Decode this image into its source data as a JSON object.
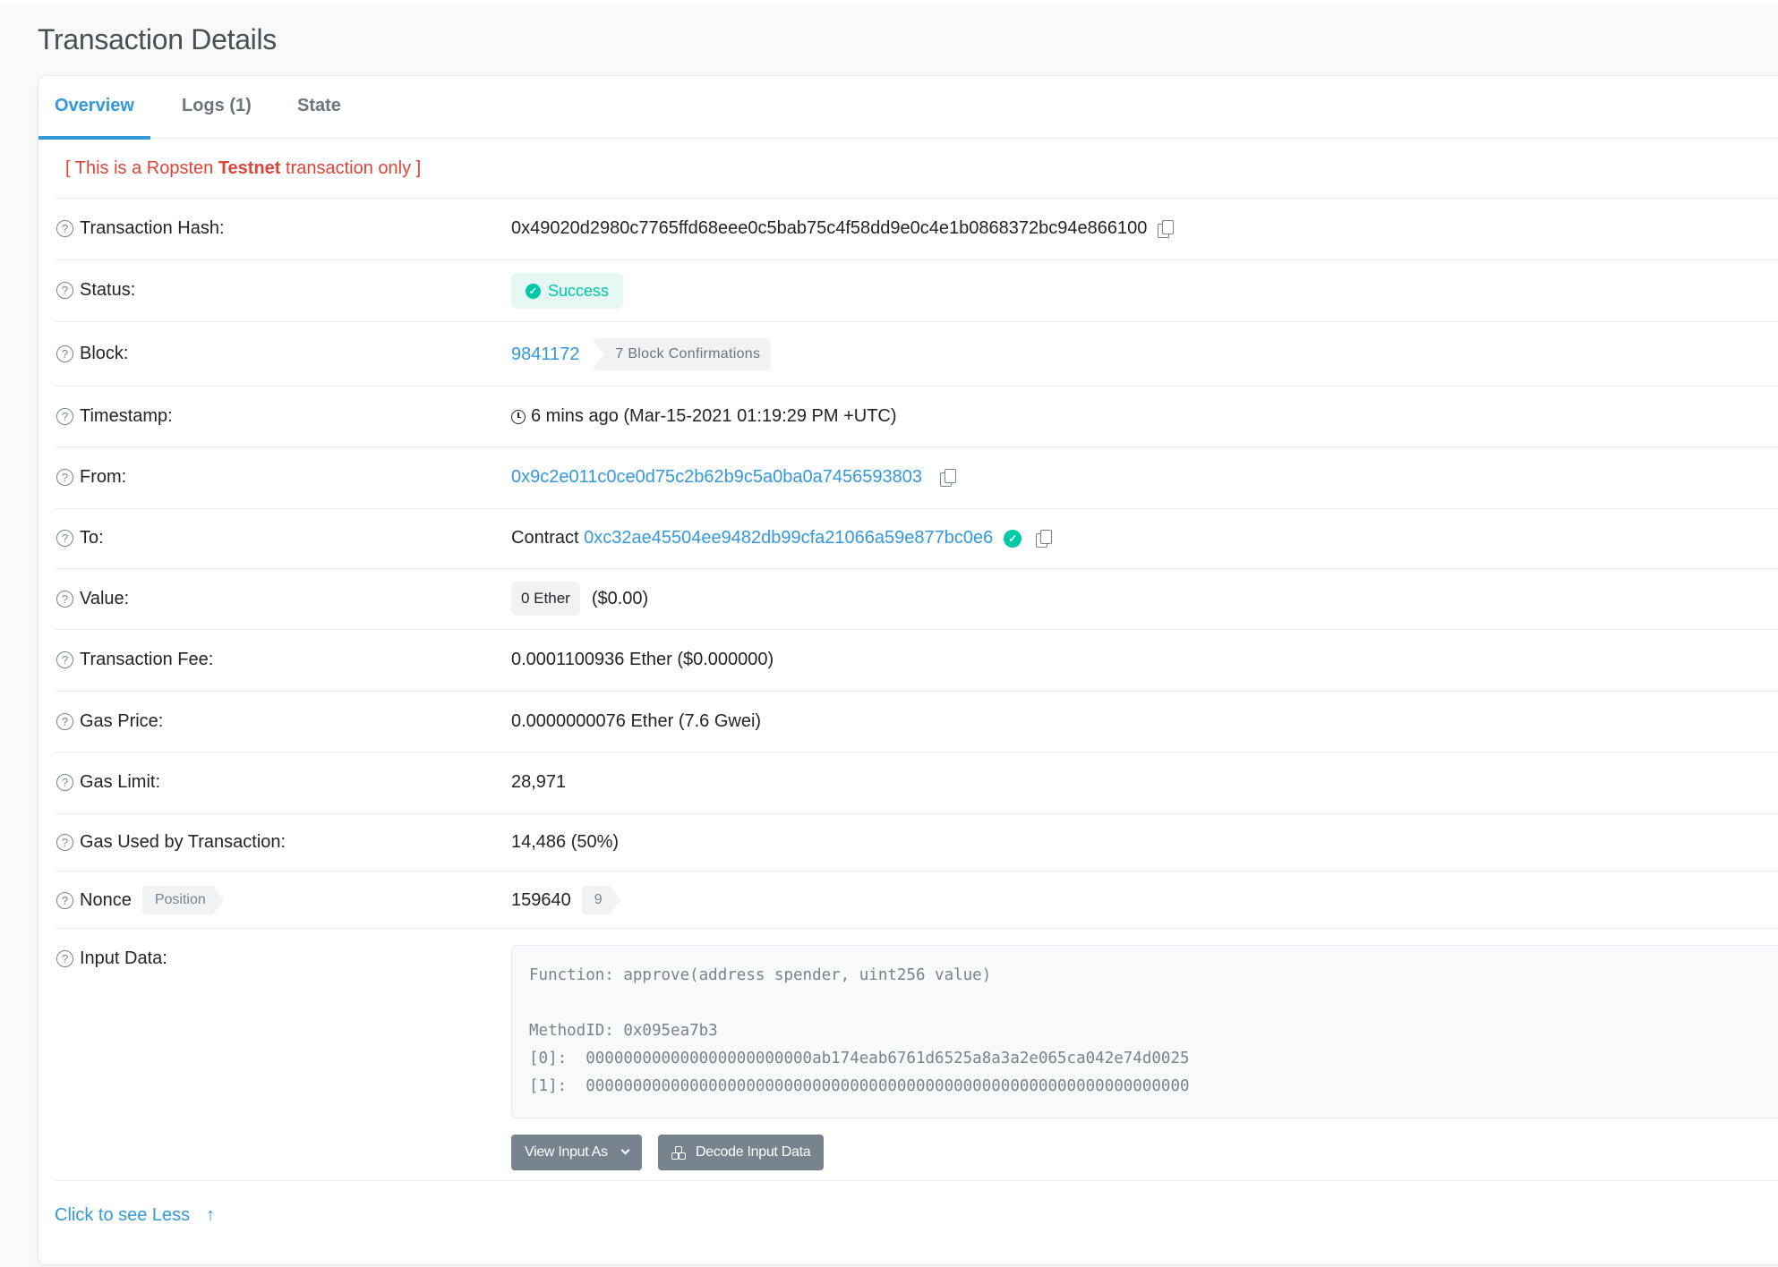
{
  "page": {
    "title": "Transaction Details"
  },
  "tabs": [
    {
      "label": "Overview",
      "active": true
    },
    {
      "label": "Logs (1)",
      "active": false
    },
    {
      "label": "State",
      "active": false
    }
  ],
  "banner": {
    "prefix": "[ This is a Ropsten ",
    "bold": "Testnet",
    "suffix": " transaction only ]"
  },
  "rows": {
    "hash": {
      "label": "Transaction Hash:",
      "value": "0x49020d2980c7765ffd68eee0c5bab75c4f58dd9e0c4e1b0868372bc94e866100"
    },
    "status": {
      "label": "Status:",
      "value": "Success"
    },
    "block": {
      "label": "Block:",
      "value": "9841172",
      "confirmations": "7 Block Confirmations"
    },
    "timestamp": {
      "label": "Timestamp:",
      "value": "6 mins ago (Mar-15-2021 01:19:29 PM +UTC)"
    },
    "from": {
      "label": "From:",
      "value": "0x9c2e011c0ce0d75c2b62b9c5a0ba0a7456593803"
    },
    "to": {
      "label": "To:",
      "prefix": "Contract",
      "value": "0xc32ae45504ee9482db99cfa21066a59e877bc0e6"
    },
    "value": {
      "label": "Value:",
      "amount": "0 Ether",
      "usd": "($0.00)"
    },
    "fee": {
      "label": "Transaction Fee:",
      "value": "0.0001100936 Ether ($0.000000)"
    },
    "gas_price": {
      "label": "Gas Price:",
      "value": "0.0000000076 Ether (7.6 Gwei)"
    },
    "gas_limit": {
      "label": "Gas Limit:",
      "value": "28,971"
    },
    "gas_used": {
      "label": "Gas Used by Transaction:",
      "value": "14,486 (50%)"
    },
    "nonce": {
      "label": "Nonce",
      "position_label": "Position",
      "value": "159640",
      "position": "9"
    },
    "input": {
      "label": "Input Data:",
      "lines": [
        "Function: approve(address spender, uint256 value)",
        "",
        "MethodID: 0x095ea7b3",
        "[0]:  000000000000000000000000ab174eab6761d6525a8a3a2e065ca042e74d0025",
        "[1]:  0000000000000000000000000000000000000000000000000000000000000000"
      ],
      "view_as_label": "View Input As",
      "decode_label": "Decode Input Data"
    }
  },
  "footer": {
    "see_less": "Click to see Less"
  },
  "colors": {
    "accent": "#3498db",
    "success": "#00c9a7",
    "danger": "#de4437",
    "muted": "#77838f"
  }
}
